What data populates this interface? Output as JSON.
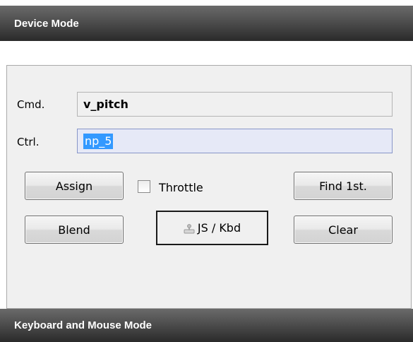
{
  "headers": {
    "device_mode": "Device Mode",
    "keyboard_mouse_mode": "Keyboard and Mouse Mode"
  },
  "form": {
    "cmd_label": "Cmd.",
    "cmd_value": "v_pitch",
    "ctrl_label": "Ctrl.",
    "ctrl_value": "np_5"
  },
  "buttons": {
    "assign": "Assign",
    "find_first": "Find 1st.",
    "blend": "Blend",
    "js_kbd": "JS / Kbd",
    "clear": "Clear"
  },
  "throttle": {
    "label": "Throttle",
    "checked": false
  },
  "icons": {
    "js_kbd": "joystick-icon"
  },
  "colors": {
    "header_bg": "#4e4e4e",
    "selection": "#3399ff",
    "edit_field_bg": "#e6e9f7"
  }
}
